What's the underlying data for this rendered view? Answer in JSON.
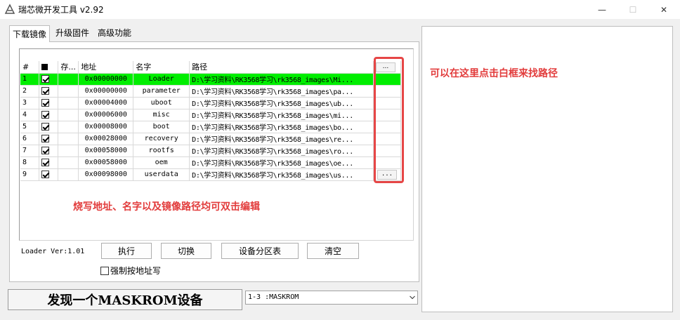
{
  "window": {
    "title": "瑞芯微开发工具 v2.92",
    "minimize_glyph": "—",
    "maximize_glyph": "☐",
    "close_glyph": "✕"
  },
  "tabs": [
    {
      "label": "下载镜像",
      "active": true
    },
    {
      "label": "升级固件",
      "active": false
    },
    {
      "label": "高级功能",
      "active": false
    }
  ],
  "table": {
    "headers": [
      "#",
      "",
      "存...",
      "地址",
      "名字",
      "路径",
      "..."
    ],
    "rows": [
      {
        "no": "1",
        "checked": true,
        "address": "0x00000000",
        "name": "Loader",
        "path": "D:\\学习资料\\RK3568学习\\rk3568_images\\Mi...",
        "selected": true
      },
      {
        "no": "2",
        "checked": true,
        "address": "0x00000000",
        "name": "parameter",
        "path": "D:\\学习资料\\RK3568学习\\rk3568_images\\pa..."
      },
      {
        "no": "3",
        "checked": true,
        "address": "0x00004000",
        "name": "uboot",
        "path": "D:\\学习资料\\RK3568学习\\rk3568_images\\ub..."
      },
      {
        "no": "4",
        "checked": true,
        "address": "0x00006000",
        "name": "misc",
        "path": "D:\\学习资料\\RK3568学习\\rk3568_images\\mi..."
      },
      {
        "no": "5",
        "checked": true,
        "address": "0x00008000",
        "name": "boot",
        "path": "D:\\学习资料\\RK3568学习\\rk3568_images\\bo..."
      },
      {
        "no": "6",
        "checked": true,
        "address": "0x00028000",
        "name": "recovery",
        "path": "D:\\学习资料\\RK3568学习\\rk3568_images\\re..."
      },
      {
        "no": "7",
        "checked": true,
        "address": "0x00058000",
        "name": "rootfs",
        "path": "D:\\学习资料\\RK3568学习\\rk3568_images\\ro..."
      },
      {
        "no": "8",
        "checked": true,
        "address": "0x00058000",
        "name": "oem",
        "path": "D:\\学习资料\\RK3568学习\\rk3568_images\\oe..."
      },
      {
        "no": "9",
        "checked": true,
        "address": "0x00098000",
        "name": "userdata",
        "path": "D:\\学习资料\\RK3568学习\\rk3568_images\\us...",
        "show_browse": true
      }
    ],
    "browse_label": "..."
  },
  "annotations": {
    "browse_hint": "可以在这里点击白框来找路径",
    "edit_hint": "烧写地址、名字以及镜像路径均可双击编辑"
  },
  "controls": {
    "loader_version": "Loader Ver:1.01",
    "execute": "执行",
    "switch": "切换",
    "partition_table": "设备分区表",
    "clear": "清空",
    "force_by_address": "强制按地址写"
  },
  "status": {
    "message": "发现一个MASKROM设备",
    "device_select": "1-3 :MASKROM"
  },
  "colors": {
    "selected_row": "#00ee00",
    "annotation_red": "#e23c3c"
  }
}
